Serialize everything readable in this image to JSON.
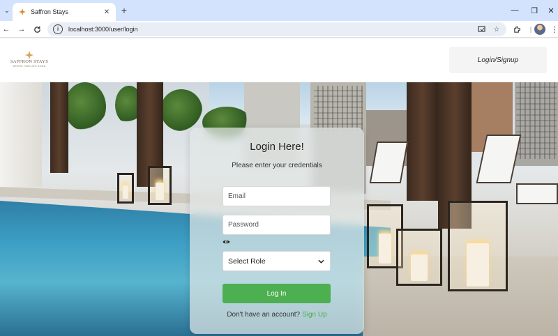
{
  "browser": {
    "tab_title": "Saffron Stays",
    "tab_close": "✕",
    "new_tab": "+",
    "url": "localhost:3000/user/login",
    "back": "←",
    "forward": "→",
    "reload": "C",
    "minimize": "—",
    "restore": "❐",
    "close": "✕"
  },
  "header": {
    "logo_name": "SAFFRON STAYS",
    "logo_tagline": "WHERE FAMILIES BOND",
    "login_signup": "Login/Signup"
  },
  "login": {
    "title": "Login Here!",
    "subtitle": "Please enter your credentials",
    "email_placeholder": "Email",
    "password_placeholder": "Password",
    "role_selected": "Select Role",
    "submit": "Log In",
    "signup_prompt": "Don't have an account?",
    "signup_link": "Sign Up"
  },
  "colors": {
    "accent": "#4caf50",
    "brand": "#d9a257",
    "browser_frame": "#d3e3fd"
  }
}
